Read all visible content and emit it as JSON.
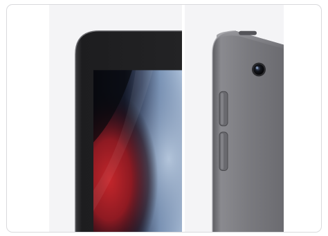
{
  "gallery": {
    "images": [
      {
        "id": "front",
        "subject": "tablet-front-corner-view"
      },
      {
        "id": "back",
        "subject": "tablet-back-corner-view"
      }
    ]
  },
  "colors": {
    "card_border": "#d9d9dc",
    "panel_background": "#f4f4f6",
    "device_frame": "#2b2b2e",
    "device_body": "#7b7b80",
    "screen_red": "#b31e24",
    "screen_blue": "#8fa6c2"
  }
}
